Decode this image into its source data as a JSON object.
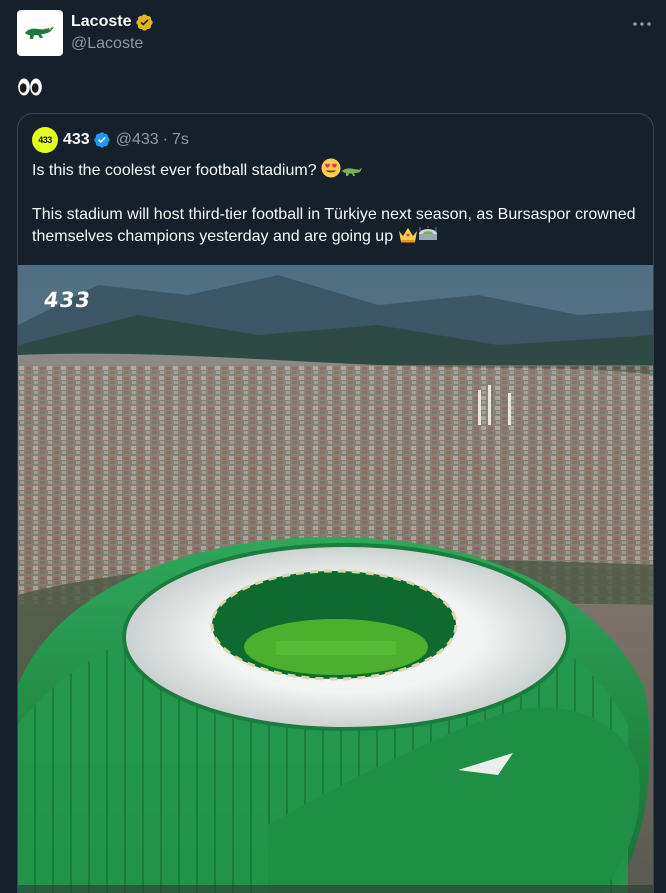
{
  "tweet": {
    "author": {
      "name": "Lacoste",
      "handle": "@Lacoste",
      "verified": "gold"
    },
    "text": "👀",
    "more_label": "More"
  },
  "quote": {
    "author": {
      "name": "433",
      "handle": "@433",
      "avatar_text": "433",
      "verified": "blue"
    },
    "separator": "·",
    "time": "7s",
    "line1": "Is this the coolest ever football stadium?",
    "line2": "This stadium will host third-tier football in Türkiye next season, as Bursaspor crowned themselves champions yesterday and are going up",
    "media": {
      "watermark": "433",
      "alt": "Aerial photo of a green crocodile-shaped football stadium in front of a city and hills"
    }
  },
  "colors": {
    "background": "#15202b",
    "text": "#f7f9f9",
    "muted": "#8b98a5",
    "border": "#38444d",
    "verified_blue": "#1d9bf0",
    "verified_gold": "#e2b719",
    "stadium_green": "#1f8f45"
  },
  "icons": {
    "verified_gold": "verified-badge-icon",
    "verified_blue": "verified-badge-icon",
    "more": "more-dots-icon"
  }
}
